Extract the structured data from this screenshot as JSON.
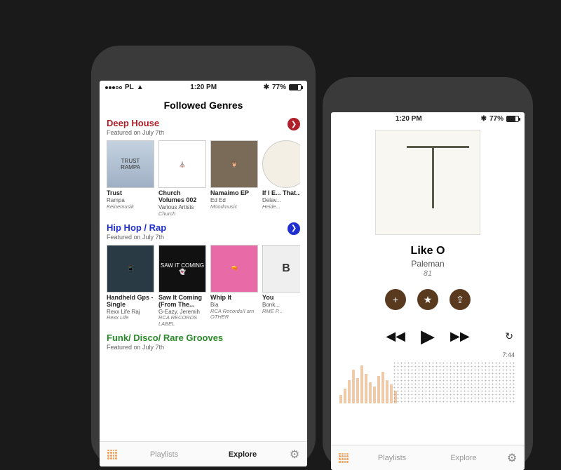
{
  "status": {
    "carrier": "PL",
    "time": "1:20 PM",
    "battery": "77%"
  },
  "page_title": "Followed Genres",
  "genres": [
    {
      "title": "Deep House",
      "color": "#b0202a",
      "subtitle": "Featured  on  July 7th",
      "albums": [
        {
          "title": "Trust",
          "artist": "Rampa",
          "label": "Keinemusik",
          "art": "art-trust"
        },
        {
          "title": "Church Volumes 002",
          "artist": "Various Artists",
          "label": "Church",
          "art": "art-church"
        },
        {
          "title": "Namaimo EP",
          "artist": "Ed Ed",
          "label": "Moodmusic",
          "art": "art-owl"
        },
        {
          "title": "If I E... That...",
          "artist": "Delav...",
          "label": "Heide...",
          "art": "art-if"
        }
      ]
    },
    {
      "title": "Hip Hop / Rap",
      "color": "#2030d0",
      "subtitle": "Featured  on  July 7th",
      "albums": [
        {
          "title": "Handheld Gps - Single",
          "artist": "Rexx Life Raj",
          "label": "Rexx Life",
          "art": "art-gps"
        },
        {
          "title": "Saw It Coming (From The...",
          "artist": "G-Eazy, Jeremih",
          "label": "RCA RECORDS LABEL",
          "art": "art-saw"
        },
        {
          "title": "Whip It",
          "artist": "Bia",
          "label": "RCA Records/I am OTHER",
          "art": "art-whip"
        },
        {
          "title": "You",
          "artist": "Bonk...",
          "label": "RME P...",
          "art": "art-you"
        }
      ]
    },
    {
      "title": "Funk/ Disco/ Rare Grooves",
      "color": "#2a8a2a",
      "subtitle": "Featured  on  July 7th",
      "albums": []
    }
  ],
  "tabs": {
    "playlists": "Playlists",
    "explore": "Explore"
  },
  "player": {
    "title": "Like O",
    "artist": "Paleman",
    "album": "81",
    "duration": "7:44"
  }
}
